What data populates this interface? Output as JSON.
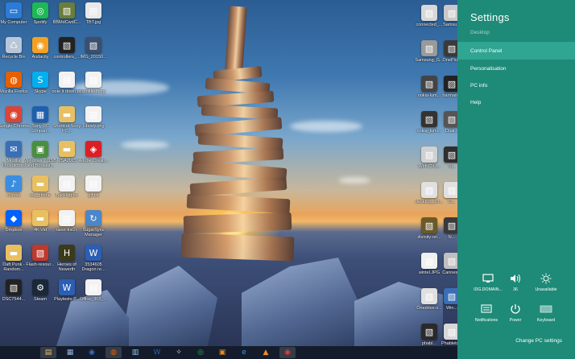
{
  "desktop": {
    "icons_left": [
      {
        "label": "My Computer",
        "icon": "computer-icon",
        "color": "#2c7bd6"
      },
      {
        "label": "Spotify",
        "icon": "spotify-icon",
        "color": "#1db954"
      },
      {
        "label": "BBMdCwdC...",
        "icon": "image-file-icon",
        "color": "#6a7d3a"
      },
      {
        "label": "TBT.jpg",
        "icon": "document-icon",
        "color": "#e9e9e9"
      },
      {
        "label": "Recycle Bin",
        "icon": "recycle-bin-icon",
        "color": "#b8c6d8"
      },
      {
        "label": "Audacity",
        "icon": "audacity-icon",
        "color": "#f4a122"
      },
      {
        "label": "controllers_...",
        "icon": "image-file-icon",
        "color": "#222222"
      },
      {
        "label": "IMG_20150...",
        "icon": "image-file-icon",
        "color": "#3b4f6e"
      },
      {
        "label": "Mozilla Firefox",
        "icon": "firefox-icon",
        "color": "#e66000"
      },
      {
        "label": "Skype",
        "icon": "skype-icon",
        "color": "#00aff0"
      },
      {
        "label": "note it down.txt",
        "icon": "document-icon",
        "color": "#f2f2f2"
      },
      {
        "label": "Untitled.png",
        "icon": "image-file-icon",
        "color": "#f2f2f2"
      },
      {
        "label": "Google Chrome",
        "icon": "chrome-icon",
        "color": "#db4437"
      },
      {
        "label": "Sony PC Compan...",
        "icon": "sony-icon",
        "color": "#1f5fae"
      },
      {
        "label": "Shortcut Sony PC...",
        "icon": "folder-icon",
        "color": "#e8c062"
      },
      {
        "label": "Library.png",
        "icon": "image-file-icon",
        "color": "#f2f2f2"
      },
      {
        "label": "Mozilla Thunderbird",
        "icon": "thunderbird-icon",
        "color": "#3a6fb7"
      },
      {
        "label": "Windows 7 USB and Bootabl...",
        "icon": "usb-tool-icon",
        "color": "#4a8f3c"
      },
      {
        "label": "MSA2015",
        "icon": "folder-icon",
        "color": "#e8c062"
      },
      {
        "label": "Adobe Creati...",
        "icon": "adobe-cc-icon",
        "color": "#da1f26"
      },
      {
        "label": "iTunes",
        "icon": "itunes-icon",
        "color": "#3c8de0"
      },
      {
        "label": "old_phone",
        "icon": "folder-icon",
        "color": "#e8c062"
      },
      {
        "label": "Backlog.txt",
        "icon": "document-icon",
        "color": "#f2f2f2"
      },
      {
        "label": "gif.txt",
        "icon": "document-icon",
        "color": "#f2f2f2"
      },
      {
        "label": "Dropbox",
        "icon": "dropbox-icon",
        "color": "#0061fe"
      },
      {
        "label": "4K Vid",
        "icon": "folder-icon",
        "color": "#e8c062"
      },
      {
        "label": "razor-list2c",
        "icon": "document-icon",
        "color": "#f2f2f2"
      },
      {
        "label": "SugarSync Manager",
        "icon": "sugarsync-icon",
        "color": "#4b86c8"
      },
      {
        "label": "Daft Punk - Random...",
        "icon": "folder-icon",
        "color": "#e8c062"
      },
      {
        "label": "Flash-resour...",
        "icon": "image-file-icon",
        "color": "#c0392b"
      },
      {
        "label": "Heroes of Newerth",
        "icon": "hon-icon",
        "color": "#3b3b1a"
      },
      {
        "label": "3534605 Dragon re...",
        "icon": "word-doc-icon",
        "color": "#2b5fb4"
      },
      {
        "label": "DSC7544...",
        "icon": "image-file-icon",
        "color": "#222222"
      },
      {
        "label": "Steam",
        "icon": "steam-icon",
        "color": "#1b2838"
      },
      {
        "label": "Playtests-P...",
        "icon": "word-doc-icon",
        "color": "#2b5fb4"
      },
      {
        "label": "Office_365_...",
        "icon": "document-icon",
        "color": "#f2f2f2"
      }
    ],
    "icons_right": [
      {
        "label": "connected_...",
        "icon": "image-file-icon",
        "color": "#d8d8d8"
      },
      {
        "label": "Samsu...",
        "icon": "image-file-icon",
        "color": "#c9c9c9"
      },
      {
        "label": "Samsung_G...",
        "icon": "image-file-icon",
        "color": "#9a9a9a"
      },
      {
        "label": "OnePlu...",
        "icon": "image-file-icon",
        "color": "#3a3a3a"
      },
      {
        "label": "nokia-lum...",
        "icon": "image-file-icon",
        "color": "#444444"
      },
      {
        "label": "harman...",
        "icon": "image-file-icon",
        "color": "#222222"
      },
      {
        "label": "nokia_lumi...",
        "icon": "image-file-icon",
        "color": "#333333"
      },
      {
        "label": "Dual...",
        "icon": "image-file-icon",
        "color": "#555555"
      },
      {
        "label": "Wi-fi C-U...",
        "icon": "image-file-icon",
        "color": "#d0d0d0"
      },
      {
        "label": "S...",
        "icon": "image-file-icon",
        "color": "#2f2f2f"
      },
      {
        "label": "desktop_scr...",
        "icon": "image-file-icon",
        "color": "#e0e0e0"
      },
      {
        "label": "U...",
        "icon": "image-file-icon",
        "color": "#e0e0e0"
      },
      {
        "label": "divinity-ori...",
        "icon": "image-file-icon",
        "color": "#6a5a2a"
      },
      {
        "label": "N...",
        "icon": "image-file-icon",
        "color": "#3a3a3a"
      },
      {
        "label": "wintel.JPG",
        "icon": "image-file-icon",
        "color": "#f0f0f0"
      },
      {
        "label": "Cannes...",
        "icon": "image-file-icon",
        "color": "#c0c0c0"
      },
      {
        "label": "Onedrive-s...",
        "icon": "image-file-icon",
        "color": "#e0e0e0"
      },
      {
        "label": "Win...",
        "icon": "image-file-icon",
        "color": "#3a6fb7"
      },
      {
        "label": "phabl...",
        "icon": "image-file-icon",
        "color": "#2a2a2a"
      },
      {
        "label": "Phablets...",
        "icon": "image-file-icon",
        "color": "#d8d8d8"
      }
    ]
  },
  "taskbar": {
    "start_icon": "windows-start-icon",
    "items": [
      {
        "name": "file-explorer-icon",
        "glyph": "▤",
        "color": "#e8c062"
      },
      {
        "name": "photos-icon",
        "glyph": "▦",
        "color": "#8fb7e0"
      },
      {
        "name": "thunderbird-icon",
        "glyph": "◉",
        "color": "#3a6fb7"
      },
      {
        "name": "firefox-icon",
        "glyph": "◍",
        "color": "#e66000"
      },
      {
        "name": "notes-icon",
        "glyph": "▥",
        "color": "#8ec5e8"
      },
      {
        "name": "word-icon",
        "glyph": "W",
        "color": "#2b5fb4"
      },
      {
        "name": "satellite-icon",
        "glyph": "✧",
        "color": "#d0d0d0"
      },
      {
        "name": "spotify-icon",
        "glyph": "◎",
        "color": "#1db954"
      },
      {
        "name": "store-icon",
        "glyph": "▣",
        "color": "#f38b1a"
      },
      {
        "name": "ie-icon",
        "glyph": "e",
        "color": "#3c9be0"
      },
      {
        "name": "vlc-icon",
        "glyph": "▲",
        "color": "#f58a1f"
      },
      {
        "name": "chrome-icon",
        "glyph": "◉",
        "color": "#db4437"
      }
    ]
  },
  "charm": {
    "title": "Settings",
    "subtitle": "Desktop",
    "menu": [
      {
        "label": "Control Panel",
        "selected": true
      },
      {
        "label": "Personalisation",
        "selected": false
      },
      {
        "label": "PC info",
        "selected": false
      },
      {
        "label": "Help",
        "selected": false
      }
    ],
    "tiles": [
      {
        "label": "IDG.DOMAIN...",
        "icon": "network-icon",
        "glyph": "🖥"
      },
      {
        "label": "36",
        "icon": "volume-icon",
        "glyph": "🔊"
      },
      {
        "label": "Unavailable",
        "icon": "brightness-icon",
        "glyph": "☼"
      },
      {
        "label": "Notifications",
        "icon": "notifications-icon",
        "glyph": "▭"
      },
      {
        "label": "Power",
        "icon": "power-icon",
        "glyph": "⏻"
      },
      {
        "label": "Keyboard",
        "icon": "keyboard-icon",
        "glyph": "⌨"
      }
    ],
    "change_pc_settings": "Change PC settings",
    "colors": {
      "background": "#1e8a78",
      "selected": "#2fa592"
    }
  }
}
